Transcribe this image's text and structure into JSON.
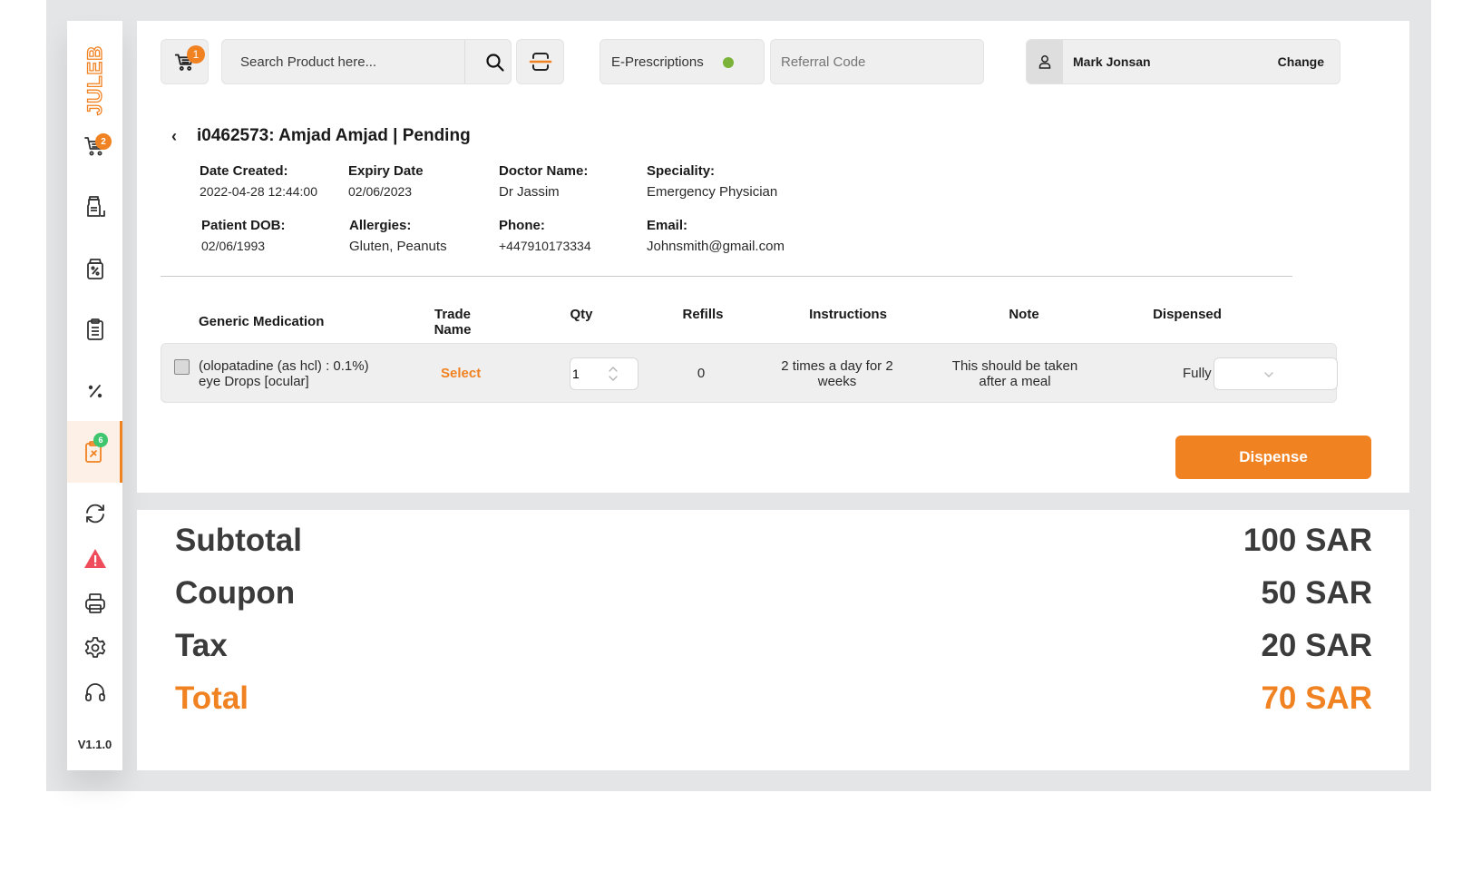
{
  "brand": {
    "logo_text": "JULEB",
    "accent": "#f08222"
  },
  "sidebar": {
    "items": [
      {
        "name": "cart",
        "badge": "2"
      },
      {
        "name": "inventory"
      },
      {
        "name": "discount-bag"
      },
      {
        "name": "orders-list"
      },
      {
        "name": "percent"
      },
      {
        "name": "prescriptions",
        "badge": "6",
        "active": true
      },
      {
        "name": "sync"
      },
      {
        "name": "alerts"
      },
      {
        "name": "printer"
      },
      {
        "name": "settings"
      },
      {
        "name": "support"
      }
    ],
    "version": "V1.1.0"
  },
  "header": {
    "cart_badge": "1",
    "search_placeholder": "Search Product here...",
    "eprescriptions_label": "E-Prescriptions",
    "referral_placeholder": "Referral Code",
    "user_name": "Mark Jonsan",
    "change_label": "Change"
  },
  "prescription": {
    "title": "i0462573: Amjad Amjad | Pending",
    "fields": {
      "date_created": {
        "label": "Date Created:",
        "value": "2022-04-28 12:44:00"
      },
      "expiry_date": {
        "label": "Expiry Date",
        "value": "02/06/2023"
      },
      "doctor_name": {
        "label": "Doctor Name:",
        "value": "Dr Jassim"
      },
      "speciality": {
        "label": "Speciality:",
        "value": "Emergency Physician"
      },
      "patient_dob": {
        "label": "Patient DOB:",
        "value": "02/06/1993"
      },
      "allergies": {
        "label": "Allergies:",
        "value": "Gluten, Peanuts"
      },
      "phone": {
        "label": "Phone:",
        "value": "+447910173334"
      },
      "email": {
        "label": "Email:",
        "value": "Johnsmith@gmail.com"
      }
    }
  },
  "table": {
    "headers": {
      "generic": "Generic Medication",
      "trade_1": "Trade",
      "trade_2": "Name",
      "qty": "Qty",
      "refills": "Refills",
      "instructions": "Instructions",
      "note": "Note",
      "dispensed": "Dispensed"
    },
    "rows": [
      {
        "generic_1": "(olopatadine (as hcl) : 0.1%)",
        "generic_2": "eye Drops [ocular]",
        "trade_name": "Select",
        "qty": "1",
        "refills": "0",
        "instructions_1": "2 times a day for 2",
        "instructions_2": "weeks",
        "note_1": "This should be taken",
        "note_2": "after a meal",
        "dispensed": "Fully"
      }
    ]
  },
  "actions": {
    "dispense_label": "Dispense"
  },
  "summary": {
    "subtotal_label": "Subtotal",
    "subtotal_value": "100 SAR",
    "coupon_label": "Coupon",
    "coupon_value": "50 SAR",
    "tax_label": "Tax",
    "tax_value": "20 SAR",
    "total_label": "Total",
    "total_value": "70 SAR"
  }
}
